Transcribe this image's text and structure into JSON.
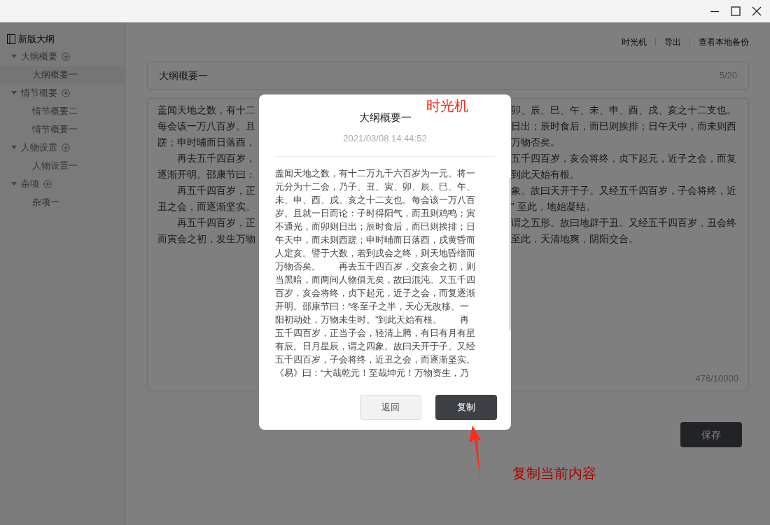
{
  "sidebar": {
    "title": "新版大纲",
    "groups": [
      {
        "label": "大纲概要",
        "expanded": true,
        "children": [
          {
            "label": "大纲概要一",
            "selected": true
          }
        ]
      },
      {
        "label": "情节概要",
        "expanded": true,
        "children": [
          {
            "label": "情节概要二",
            "selected": false
          },
          {
            "label": "情节概要一",
            "selected": false
          }
        ]
      },
      {
        "label": "人物设置",
        "expanded": true,
        "children": [
          {
            "label": "人物设置一",
            "selected": false
          }
        ]
      },
      {
        "label": "杂项",
        "expanded": true,
        "children": [
          {
            "label": "杂项一",
            "selected": false
          }
        ]
      }
    ]
  },
  "header_links": [
    "时光机",
    "导出",
    "查看本地备份"
  ],
  "title_field": {
    "value": "大纲概要一",
    "counter": "5/20"
  },
  "content_field": {
    "counter": "476/10000",
    "lines": [
      {
        "left": "盖闻天地之数，有十二",
        "right": "卯、辰、巳、午、未、申、酉、戌、亥之十二支也。"
      },
      {
        "left": "每会该一万八百岁。且",
        "right": "日出；辰时食后，而巳则挨排；日午天中，而未则西"
      },
      {
        "left": "蹉；申时晡而日落酉，",
        "right": "万物否矣。"
      },
      {
        "left": "　　再去五千四百岁，",
        "right": "五千四百岁，亥会将终，贞下起元，近子之会，而复"
      },
      {
        "left": "逐渐开明。邵康节曰：",
        "right": "到此天始有根。"
      },
      {
        "left": "　　再五千四百岁，正",
        "right": "象。故曰天开于子。又经五千四百岁，子会将终，近"
      },
      {
        "left": "丑之会，而逐渐坚实。",
        "right": "” 至此，地始凝结。"
      },
      {
        "left": "　　再五千四百岁，正",
        "right": "谓之五形。故曰地辟于丑。又经五千四百岁，丑会终"
      },
      {
        "left": "而寅会之初，发生万物",
        "right": "至此，天清地爽，阴阳交合。"
      }
    ]
  },
  "save_button": "保存",
  "dialog": {
    "title": "大纲概要一",
    "timestamp": "2021/03/08 14:44:52",
    "lines": [
      "盖闻天地之数，有十二万九千六百岁为一元。将一",
      "元分为十二会，乃子、丑、寅、卯、辰、巳、午、",
      "未、申、酉、戌、亥之十二支也。每会该一万八百",
      "岁。且就一日而论：子时得阳气，而丑则鸡鸣；寅",
      "不通光，而卯则日出；辰时食后，而巳则挨排；日",
      "午天中，而未则西蹉；申时晡而日落酉，戌黄昏而",
      "人定亥。譬于大数，若到戌会之终，则天地昏缯而",
      "万物否矣。　　再去五千四百岁，交亥会之初，则",
      "当黑暗，而两间人物俱无矣，故曰混沌。又五千四",
      "百岁，亥会将终，贞下起元，近子之会，而复逐渐",
      "开明。邵康节曰：“冬至子之半，天心无改移。一",
      "阳初动处，万物未生时。”到此天始有根。　　再",
      "五千四百岁，正当子会，轻清上腾，有日有月有星",
      "有辰。日月星辰，谓之四象。故曰天开于子。又经",
      "五千四百岁，子会将终，近丑之会，而逐渐坚实。",
      "《易》曰：“大哉乾元！至哉坤元！万物资生，乃"
    ],
    "buttons": [
      {
        "label": "返回",
        "kind": "secondary"
      },
      {
        "label": "复制",
        "kind": "primary"
      }
    ]
  },
  "annotations": {
    "dialog_label": "时光机",
    "arrow_note": "复制当前内容"
  }
}
